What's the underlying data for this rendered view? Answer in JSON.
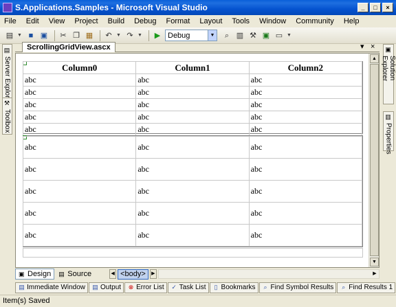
{
  "window": {
    "title": "S.Applications.Samples - Microsoft Visual Studio",
    "minimize_glyph": "_",
    "maximize_glyph": "□",
    "close_glyph": "×"
  },
  "menu": [
    "File",
    "Edit",
    "View",
    "Project",
    "Build",
    "Debug",
    "Format",
    "Layout",
    "Tools",
    "Window",
    "Community",
    "Help"
  ],
  "toolbar": {
    "config_value": "Debug",
    "icons": [
      "new-project-icon",
      "save-icon",
      "save-all-icon",
      "cut-icon",
      "copy-icon",
      "paste-icon",
      "undo-icon",
      "redo-icon",
      "start-debug-icon",
      "find-icon",
      "properties-icon",
      "toolbox-icon",
      "solution-icon",
      "class-view-icon"
    ]
  },
  "left_dock": {
    "server_explorer": "Server Explorer",
    "toolbox": "Toolbox"
  },
  "right_dock": {
    "solution_explorer": "Solution Explorer",
    "properties": "Properties"
  },
  "document": {
    "tab_label": "ScrollingGridView.ascx",
    "dropdown_glyph": "▾",
    "close_glyph": "×"
  },
  "grid_header": {
    "columns": [
      "Column0",
      "Column1",
      "Column2"
    ]
  },
  "grid_top_rows": [
    [
      "abc",
      "abc",
      "abc"
    ],
    [
      "abc",
      "abc",
      "abc"
    ],
    [
      "abc",
      "abc",
      "abc"
    ],
    [
      "abc",
      "abc",
      "abc"
    ],
    [
      "abc",
      "abc",
      "abc"
    ]
  ],
  "grid_bottom_rows": [
    [
      "abc",
      "abc",
      "abc"
    ],
    [
      "abc",
      "abc",
      "abc"
    ],
    [
      "abc",
      "abc",
      "abc"
    ],
    [
      "abc",
      "abc",
      "abc"
    ],
    [
      "abc",
      "abc",
      "abc"
    ]
  ],
  "viewbar": {
    "design_label": "Design",
    "source_label": "Source",
    "breadcrumb": "<body>"
  },
  "bottom_tabs": [
    "Immediate Window",
    "Output",
    "Error List",
    "Task List",
    "Bookmarks",
    "Find Symbol Results",
    "Find Results 1"
  ],
  "status": {
    "text": "Item(s) Saved"
  }
}
